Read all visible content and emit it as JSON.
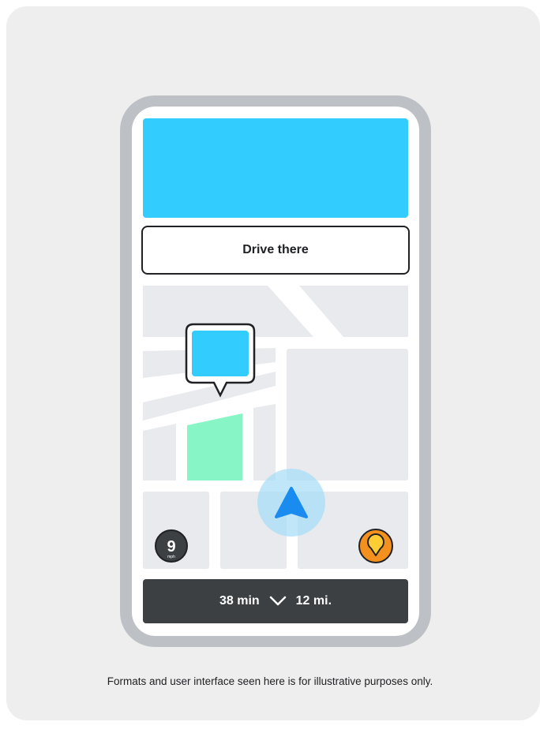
{
  "screen": {
    "drive_button_label": "Drive there",
    "speed": {
      "value": "9",
      "unit": "mph"
    },
    "trip": {
      "duration": "38 min",
      "distance": "12 mi."
    }
  },
  "footnote": "Formats and user interface seen here is for illustrative purposes only.",
  "colors": {
    "banner": "#33ccff",
    "park": "#87f5c6",
    "navigation_arrow": "#1a8cf0",
    "destination_pin": "#f4911e",
    "bottom_bar": "#3c4043"
  },
  "icons": [
    "navigation-arrow-icon",
    "destination-pin-icon",
    "chevron-down-icon",
    "speedometer-badge"
  ]
}
